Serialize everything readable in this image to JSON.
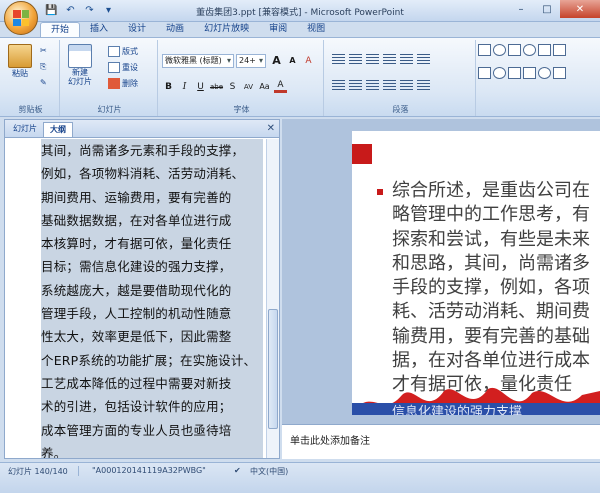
{
  "window": {
    "title": "董齿集团3.ppt [兼容模式] - Microsoft PowerPoint",
    "minimize": "–",
    "maximize": "□",
    "close": "✕"
  },
  "qat": {
    "save": "💾",
    "undo": "↶",
    "redo": "↷",
    "more": "▾"
  },
  "tabs": [
    "开始",
    "插入",
    "设计",
    "动画",
    "幻灯片放映",
    "审阅",
    "视图"
  ],
  "ribbon": {
    "clipboard": {
      "paste": "粘贴",
      "cut": "✂",
      "copy": "⎘",
      "painter": "✎",
      "label": "剪贴板"
    },
    "slides": {
      "new_slide": "新建\n幻灯片",
      "layout": "版式",
      "reset": "重设",
      "delete": "删除",
      "label": "幻灯片"
    },
    "font": {
      "font_name": "微软雅黑 (标题)",
      "font_size": "24+",
      "grow": "A",
      "shrink": "A",
      "clear": "A",
      "bold": "B",
      "italic": "I",
      "underline": "U",
      "strike": "abe",
      "shadow": "S",
      "spacing": "AV",
      "case": "Aa",
      "color": "A",
      "label": "字体"
    },
    "paragraph": {
      "label": "段落"
    }
  },
  "pane": {
    "tab_slides": "幻灯片",
    "tab_outline": "大纲",
    "outline_lines": [
      "其间，尚需诸多元素和手段的支撑，",
      "例如，各项物料消耗、活劳动消耗、",
      "期间费用、运输费用，要有完善的",
      "基础数据数据，在对各单位进行成",
      "本核算时，才有据可依，量化责任",
      "目标；需信息化建设的强力支撑，",
      "系统越庞大，越是要借助现代化的",
      "管理手段，人工控制的机动性随意",
      "性太大，效率更是低下，因此需整",
      "个ERP系统的功能扩展；在实施设计、",
      "工艺成本降低的过程中需要对新技",
      "术的引进，包括设计软件的应用；",
      "成本管理方面的专业人员也亟待培",
      "养。"
    ]
  },
  "slide": {
    "lines": [
      "综合所述，是重齿公司在",
      "略管理中的工作思考，有",
      "探索和尝试，有些是未来",
      "和思路，其间，尚需诸多",
      "手段的支撑，例如，各项",
      "耗、活劳动消耗、期间费",
      "输费用，要有完善的基础",
      "据，在对各单位进行成本",
      "才有据可依，量化责任"
    ],
    "bottom_text": "信息化建设的强力支撑",
    "accent_color": "#c81a1a"
  },
  "notes": {
    "placeholder": "单击此处添加备注"
  },
  "status": {
    "slide_count": "幻灯片 140/140",
    "theme": "\"A000120141119A32PWBG\"",
    "language": "中文(中国)"
  }
}
